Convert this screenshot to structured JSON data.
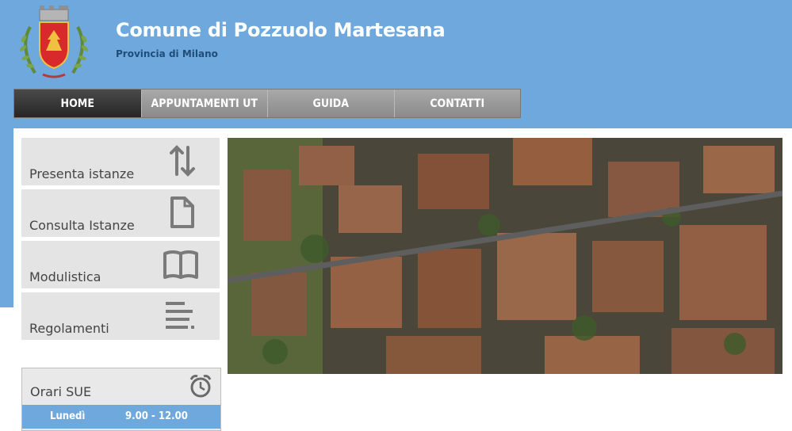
{
  "header": {
    "title": "Comune di Pozzuolo Martesana",
    "subtitle": "Provincia di Milano",
    "logo": "municipal-crest-icon"
  },
  "nav": {
    "items": [
      {
        "label": "HOME",
        "active": true
      },
      {
        "label": "APPUNTAMENTI UT",
        "active": false
      },
      {
        "label": "GUIDA",
        "active": false
      },
      {
        "label": "CONTATTI",
        "active": false
      }
    ]
  },
  "sidebar": {
    "items": [
      {
        "label": "Presenta istanze",
        "icon": "arrows-up-down-icon"
      },
      {
        "label": "Consulta Istanze",
        "icon": "document-icon"
      },
      {
        "label": "Modulistica",
        "icon": "open-book-icon"
      },
      {
        "label": "Regolamenti",
        "icon": "text-lines-icon"
      }
    ]
  },
  "hero": {
    "image": "aerial-town-photo"
  },
  "orari": {
    "title": "Orari SUE",
    "icon": "alarm-clock-icon",
    "rows": [
      {
        "day": "Lunedì",
        "time": "9.00 - 12.00"
      }
    ]
  },
  "colors": {
    "header_bg": "#6ea8dc",
    "nav_active": "#2f2f2f",
    "nav_inactive": "#999999",
    "tile_bg": "#e4e4e4",
    "subtitle": "#1f4d7a"
  }
}
